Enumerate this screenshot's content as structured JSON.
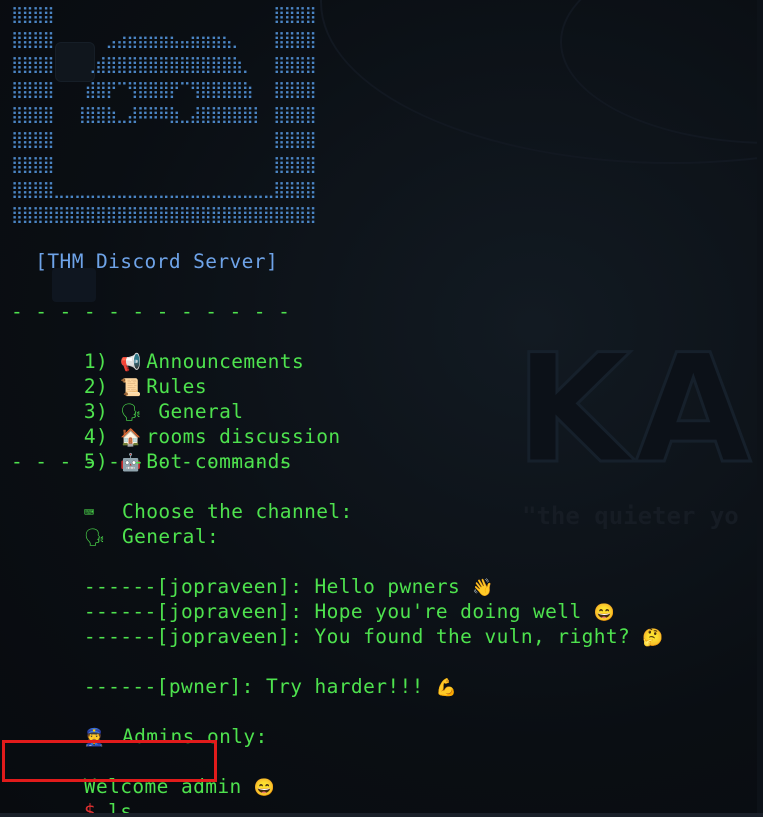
{
  "terminal": {
    "banner_lines": [
      "⣿⣿⣿⣿⠀⠀⠀⠀⠀⠀⠀⠀⠀⠀⠀⠀⠀⠀⠀⠀⠀⠀⠀⠀⠀⣿⣿⣿⣿",
      "⣿⣿⣿⣿⠀⠀⠀⠀⠀⣠⣴⣶⣶⣶⣶⣦⣤⣶⣶⣶⣦⡀⠀⠀⠀⣿⣿⣿⣿",
      "⣿⣿⣿⣿⠀⠀⠀⢀⣾⣿⣿⣿⣿⣿⣿⣿⣿⣿⣿⣿⣿⣷⡀⠀⠀⣿⣿⣿⣿",
      "⣿⣿⣿⣿⠀⠀⠀⣾⣿⡟⠉⢻⣿⣿⣿⡟⠉⢻⣿⣿⣿⣿⣷⠀⠀⣿⣿⣿⣿",
      "⣿⣿⣿⣿⠀⠀⢸⣿⣿⣷⣀⣼⠿⠿⠿⣷⣀⣼⣿⣿⣿⣿⣿⡇⠀⣿⣿⣿⣿",
      "⣿⣿⣿⣿⠀⠀⠀⠀⠀⠀⠀⠀⠀⠀⠀⠀⠀⠀⠀⠀⠀⠀⠀⠀⠀⣿⣿⣿⣿",
      "⣿⣿⣿⣿⠀⠀⠀⠀⠀⠀⠀⠀⠀⠀⠀⠀⠀⠀⠀⠀⠀⠀⠀⠀⠀⣿⣿⣿⣿",
      "⣿⣿⣿⣿⣀⣀⣀⣀⣀⣀⣀⣀⣀⣀⣀⣀⣀⣀⣀⣀⣀⣀⣀⣀⣀⣿⣿⣿⣿",
      "⣿⣿⣿⣿⣿⣿⣿⣿⣿⣿⣿⣿⣿⣿⣿⣿⣿⣿⣿⣿⣿⣿⣿⣿⣿⣿⣿⣿⣿"
    ],
    "server_title": "  [THM Discord Server]",
    "divider": "- - - - - - - - - - - -",
    "channels": [
      {
        "num": "1)",
        "icon": "📢",
        "icon_name": "megaphone-icon",
        "label": "Announcements"
      },
      {
        "num": "2)",
        "icon": "📜",
        "icon_name": "scroll-icon",
        "label": "Rules"
      },
      {
        "num": "3)",
        "icon": "🗣",
        "icon_name": "speaking-head-icon",
        "label": " General"
      },
      {
        "num": "4)",
        "icon": "🏠",
        "icon_name": "house-icon",
        "label": "rooms discussion"
      },
      {
        "num": "5)",
        "icon": "🤖",
        "icon_name": "robot-icon",
        "label": "Bot commands"
      }
    ],
    "prompt": {
      "icon": "⌨",
      "icon_name": "keyboard-icon",
      "text": " Choose the channel:"
    },
    "selected_channel": {
      "icon": "🗣",
      "icon_name": "speaking-head-icon",
      "text": " General:"
    },
    "messages": [
      {
        "text": "------[jopraveen]: Hello pwners",
        "emoji": "👋",
        "emoji_name": "waving-hand-icon"
      },
      {
        "text": "------[jopraveen]: Hope you're doing well",
        "emoji": "😄",
        "emoji_name": "smiling-face-icon"
      },
      {
        "text": "------[jopraveen]: You found the vuln, right?",
        "emoji": "🤔",
        "emoji_name": "thinking-face-icon"
      },
      {
        "text": "------[pwner]: Try harder!!!",
        "emoji": "💪",
        "emoji_name": "flexed-biceps-icon"
      }
    ],
    "admins": {
      "icon": "👮",
      "icon_name": "police-officer-icon",
      "text": " Admins only:"
    },
    "welcome": {
      "text": "Welcome admin",
      "emoji": "😄",
      "emoji_name": "smiling-face-icon"
    },
    "shell": {
      "prompt": "$",
      "command": " ls"
    }
  },
  "wallpaper": {
    "logo_text": "KAL",
    "tagline": "\"the quieter yo"
  },
  "colors": {
    "text_green": "#4ee24e",
    "banner_blue": "#4b86c6",
    "title_blue": "#6ea3e8",
    "prompt_red": "#e03030",
    "highlight_red": "#e11b1b"
  }
}
